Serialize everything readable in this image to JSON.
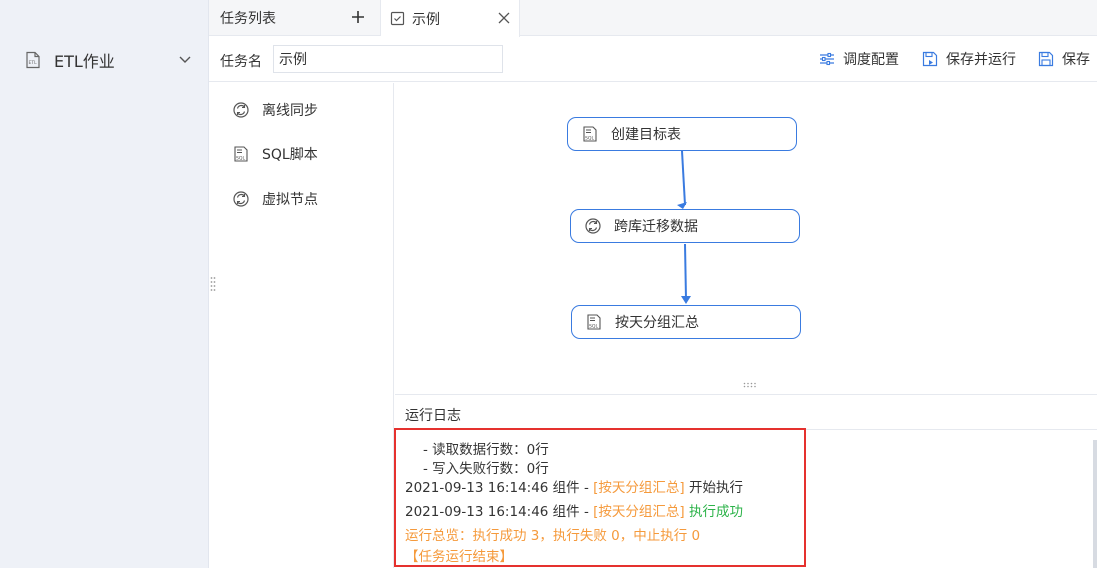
{
  "sidebar": {
    "etl_label": "ETL作业"
  },
  "tabs": {
    "task_list": "任务列表",
    "example": "示例"
  },
  "toolbar": {
    "task_name_label": "任务名",
    "task_name_value": "示例",
    "schedule": "调度配置",
    "save_run": "保存并运行",
    "save": "保存"
  },
  "node_panel": {
    "items": [
      "离线同步",
      "SQL脚本",
      "虚拟节点"
    ]
  },
  "flow": {
    "nodes": [
      "创建目标表",
      "跨库迁移数据",
      "按天分组汇总"
    ]
  },
  "log": {
    "title": "运行日志",
    "line1": "- 读取数据行数：0行",
    "line2": "- 写入失败行数：0行",
    "line3": {
      "prefix": "2021-09-13 16:14:46 组件 - ",
      "component": "[按天分组汇总]",
      "status": " 开始执行"
    },
    "line4": {
      "prefix": "2021-09-13 16:14:46 组件 - ",
      "component": "[按天分组汇总]",
      "status": " 执行成功"
    },
    "summary": "运行总览：执行成功 3，执行失败 0，中止执行 0",
    "end": "【任务运行结束】"
  },
  "colors": {
    "accent": "#3a7be0",
    "orange": "#f59a3c",
    "green": "#2db34a",
    "highlight": "#e5312e"
  }
}
